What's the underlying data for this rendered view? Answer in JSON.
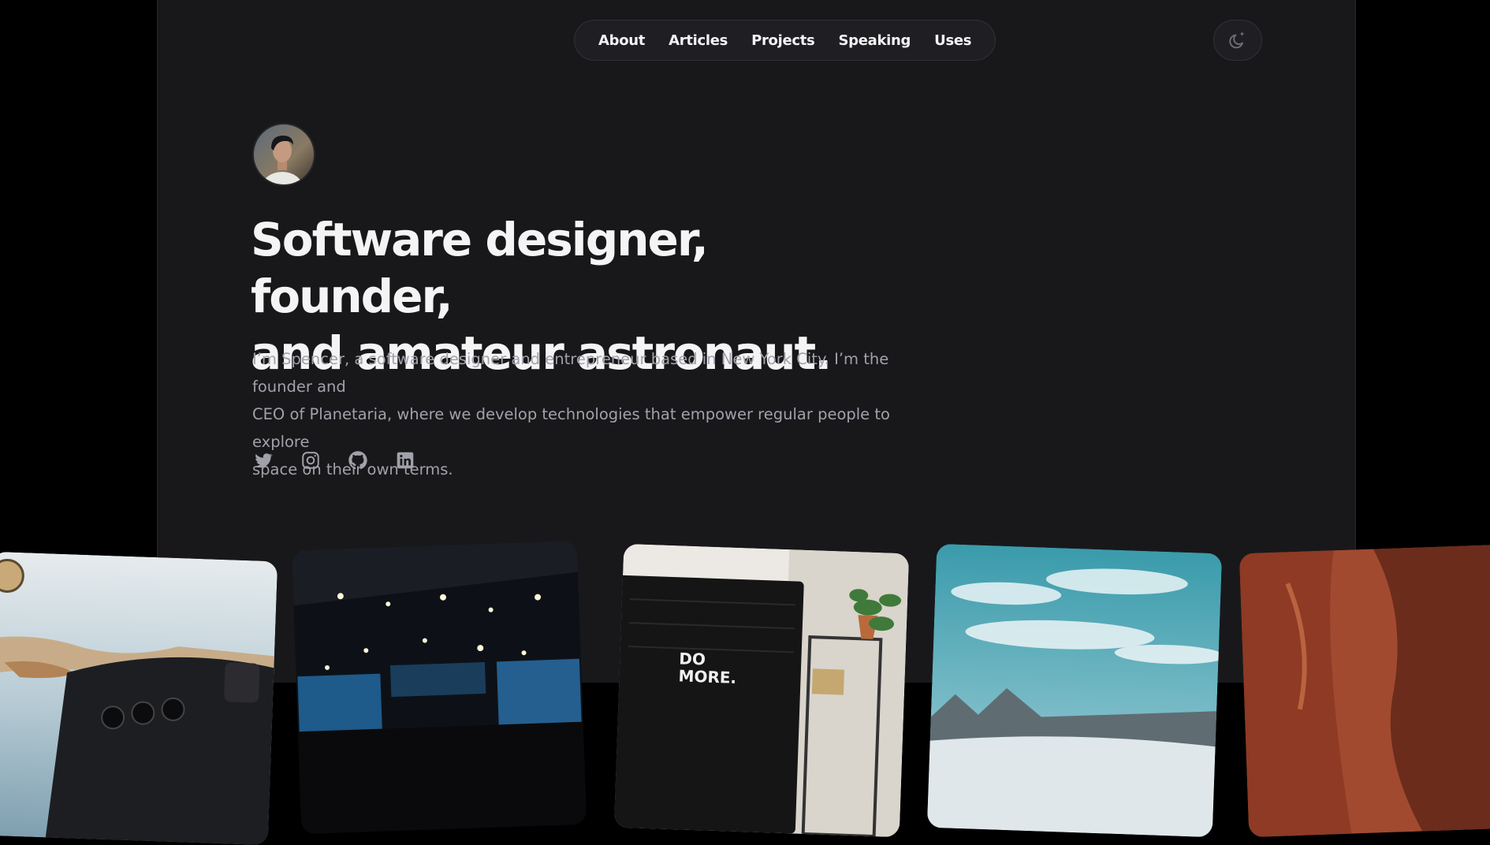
{
  "nav": {
    "items": [
      {
        "label": "About"
      },
      {
        "label": "Articles"
      },
      {
        "label": "Projects"
      },
      {
        "label": "Speaking"
      },
      {
        "label": "Uses"
      }
    ]
  },
  "theme_toggle": {
    "icon": "moon-icon"
  },
  "hero": {
    "headline_line1": "Software designer, founder,",
    "headline_line2": "and amateur astronaut.",
    "intro_line1": "I’m Spencer, a software designer and entrepreneur based in New York City. I’m the founder and",
    "intro_line2": "CEO of Planetaria, where we develop technologies that empower regular people to explore",
    "intro_line3": "space on their own terms."
  },
  "social": {
    "icons": [
      "twitter-icon",
      "instagram-icon",
      "github-icon",
      "linkedin-icon"
    ]
  },
  "photos": [
    {
      "name": "cockpit-photo",
      "overlay_text": ""
    },
    {
      "name": "conference-photo",
      "overlay_text": ""
    },
    {
      "name": "desk-photo",
      "overlay_text": "DO MORE."
    },
    {
      "name": "mountains-photo",
      "overlay_text": ""
    },
    {
      "name": "canyon-photo",
      "overlay_text": ""
    }
  ],
  "colors": {
    "background": "#000000",
    "panel": "#18181b",
    "text": "#f4f4f5",
    "muted": "#a1a1aa"
  }
}
